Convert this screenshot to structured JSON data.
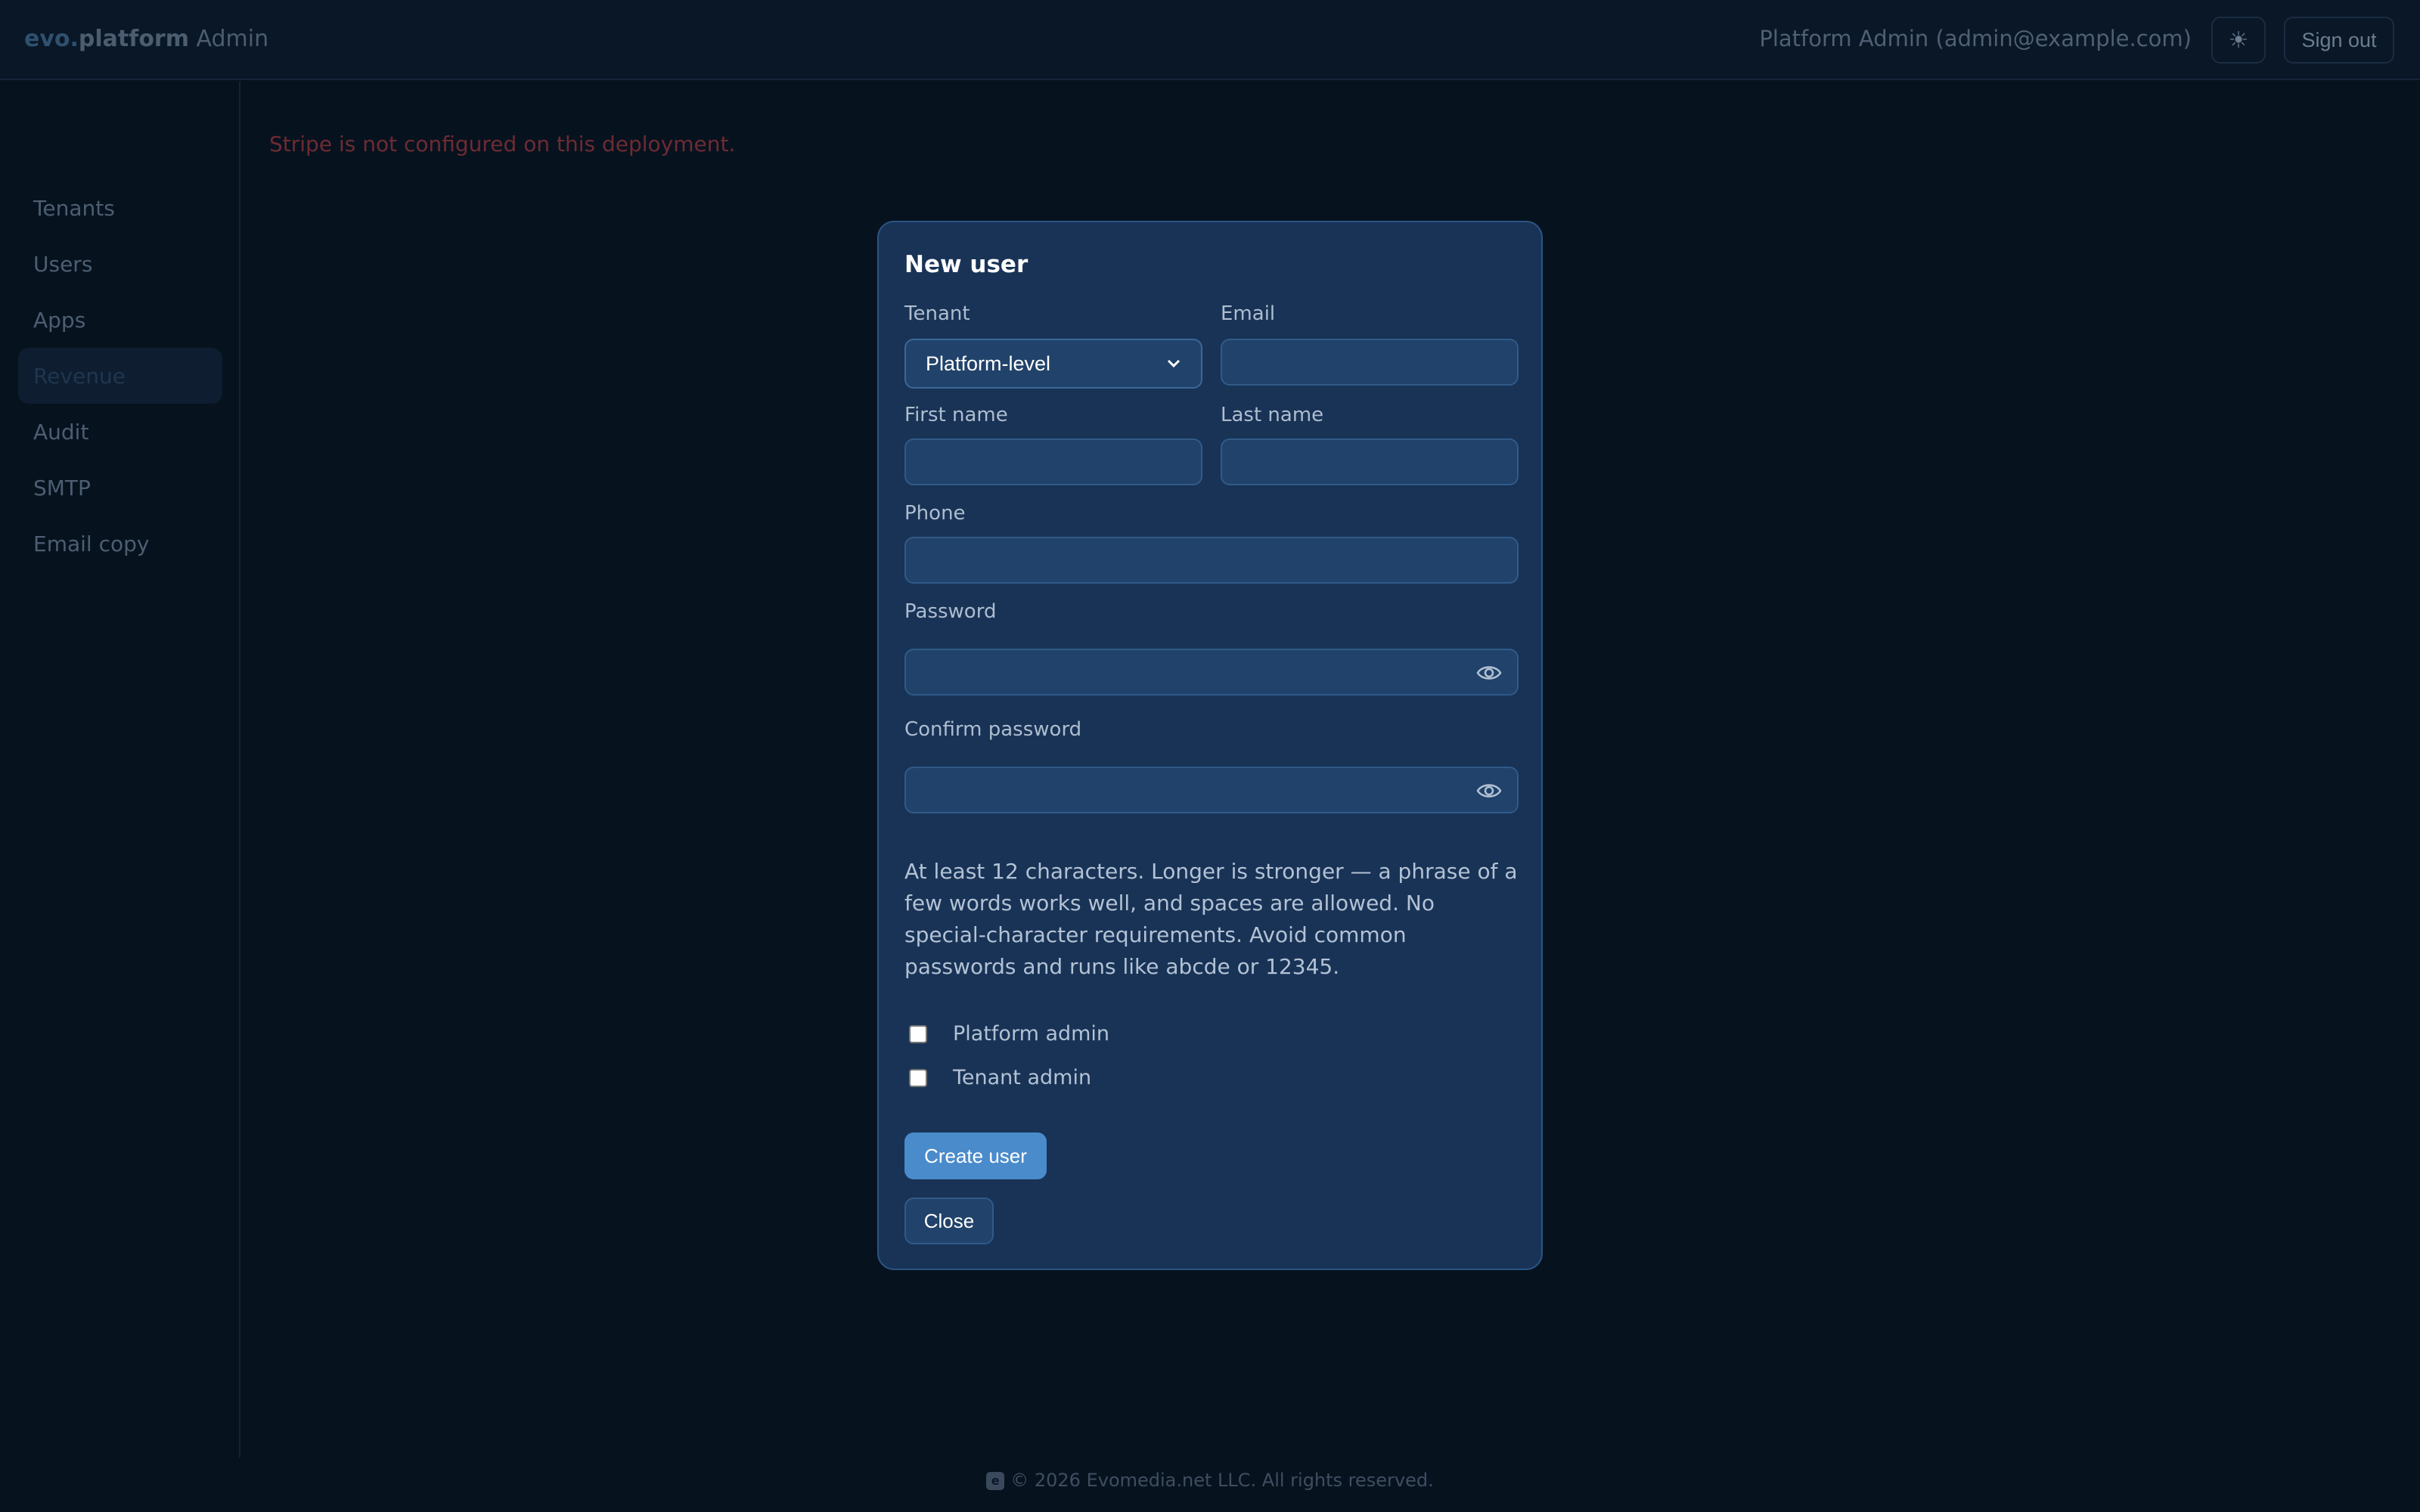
{
  "header": {
    "brand_evo": "evo.",
    "brand_platform": "platform",
    "brand_admin": " Admin",
    "user_label": "Platform Admin (admin@example.com)",
    "theme_icon": "sun-icon",
    "theme_glyph": "☀",
    "sign_out_label": "Sign out"
  },
  "sidebar": {
    "items": [
      {
        "label": "Tenants",
        "active": false
      },
      {
        "label": "Users",
        "active": false
      },
      {
        "label": "Apps",
        "active": false
      },
      {
        "label": "Revenue",
        "active": true
      },
      {
        "label": "Audit",
        "active": false
      },
      {
        "label": "SMTP",
        "active": false
      },
      {
        "label": "Email copy",
        "active": false
      }
    ]
  },
  "main": {
    "error_message": "Stripe is not configured on this deployment."
  },
  "modal": {
    "title": "New user",
    "tenant_label": "Tenant",
    "tenant_value": "Platform-level",
    "email_label": "Email",
    "email_value": "",
    "first_name_label": "First name",
    "first_name_value": "",
    "last_name_label": "Last name",
    "last_name_value": "",
    "phone_label": "Phone",
    "phone_value": "",
    "password_label": "Password",
    "password_value": "",
    "confirm_password_label": "Confirm password",
    "confirm_password_value": "",
    "password_hint": "At least 12 characters. Longer is stronger — a phrase of a few words works well, and spaces are allowed. No special-character requirements. Avoid common passwords and runs like abcde or 12345.",
    "platform_admin_label": "Platform admin",
    "platform_admin_checked": false,
    "tenant_admin_label": "Tenant admin",
    "tenant_admin_checked": false,
    "create_button": "Create user",
    "close_button": "Close"
  },
  "footer": {
    "logo_glyph": "e",
    "text": "© 2026 Evomedia.net LLC. All rights reserved."
  },
  "colors": {
    "background": "#07121f",
    "modal_bg": "#183356",
    "primary": "#4a8bcc",
    "error": "#6e2b32"
  }
}
